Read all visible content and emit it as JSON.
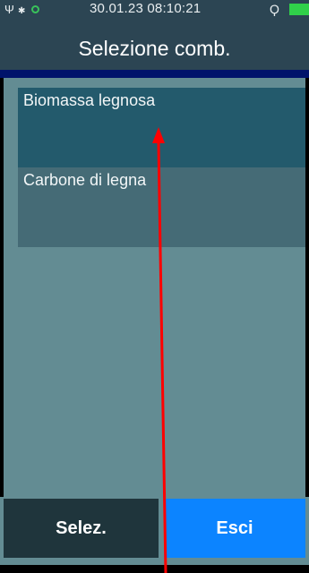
{
  "status": {
    "datetime": "30.01.23 08:10:21",
    "icons": [
      "usb-icon",
      "bluetooth-icon",
      "gps-icon",
      "plug-icon",
      "battery-icon"
    ],
    "battery_color": "#30d04a"
  },
  "header": {
    "title": "Selezione comb."
  },
  "list": {
    "items": [
      {
        "label": "Biomassa legnosa",
        "selected": true
      },
      {
        "label": "Carbone di legna",
        "selected": false
      }
    ]
  },
  "buttons": {
    "select_label": "Selez.",
    "exit_label": "Esci"
  },
  "colors": {
    "header_bg": "#2c4553",
    "accent_bar": "#00136b",
    "panel_bg": "#638c93",
    "selected_item": "#235a6c",
    "item": "#456b76",
    "select_button": "#1f353c",
    "exit_button": "#0c84ff",
    "annotation_arrow": "#ff0000"
  }
}
